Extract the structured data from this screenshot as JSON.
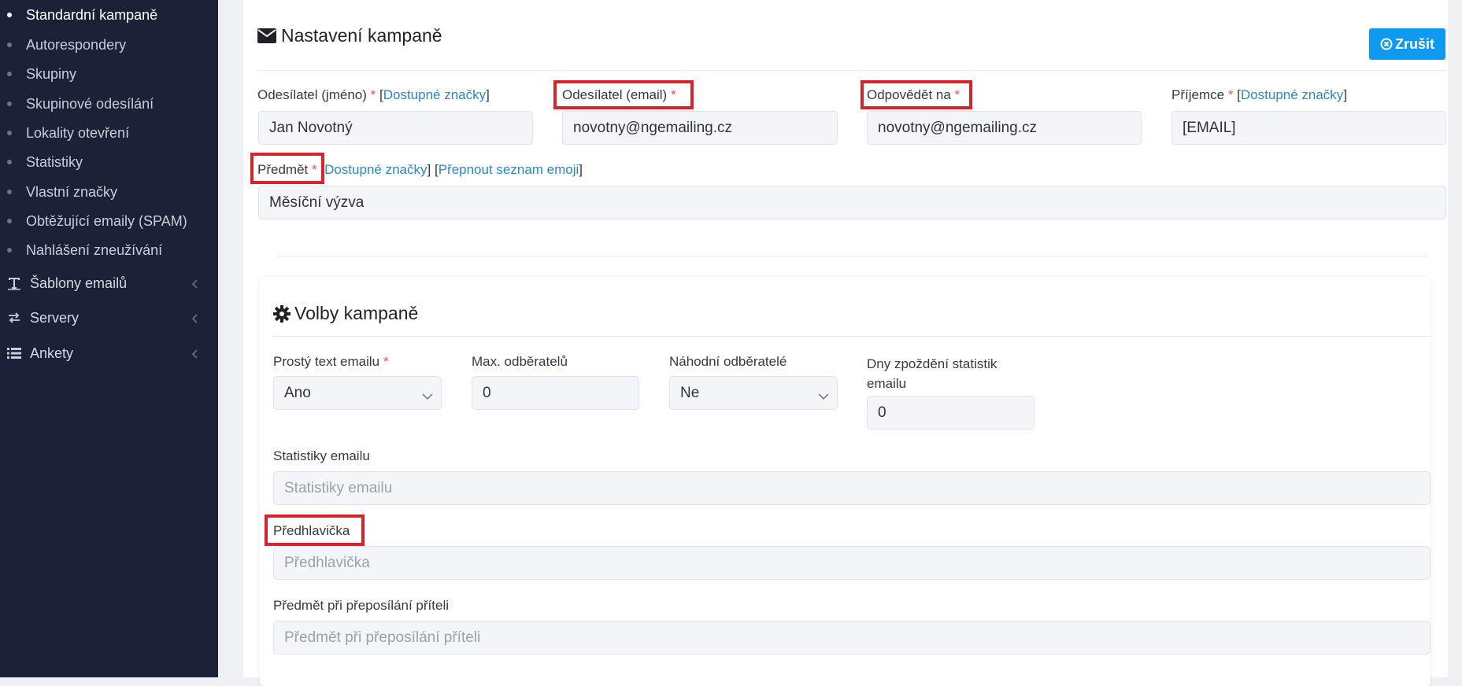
{
  "sidebar": {
    "sub_items": [
      {
        "label": "Standardní kampaně",
        "active": true
      },
      {
        "label": "Autorespondery"
      },
      {
        "label": "Skupiny"
      },
      {
        "label": "Skupinové odesílání"
      },
      {
        "label": "Lokality otevření"
      },
      {
        "label": "Statistiky"
      },
      {
        "label": "Vlastní značky"
      },
      {
        "label": "Obtěžující emaily (SPAM)"
      },
      {
        "label": "Nahlášení zneužívání"
      }
    ],
    "groups": [
      {
        "label": "Šablony emailů",
        "icon": "text-template-icon"
      },
      {
        "label": "Servery",
        "icon": "exchange-arrows-icon"
      },
      {
        "label": "Ankety",
        "icon": "list-icon"
      }
    ]
  },
  "settings": {
    "title": "Nastavení kampaně",
    "cancel_label": "Zrušit",
    "sender_name": {
      "label": "Odesílatel (jméno)",
      "tags_link": "Dostupné značky",
      "value": "Jan Novotný"
    },
    "sender_email": {
      "label": "Odesílatel (email)",
      "value": "novotny@ngemailing.cz"
    },
    "reply_to": {
      "label": "Odpovědět na",
      "value": "novotny@ngemailing.cz"
    },
    "recipient": {
      "label": "Příjemce",
      "tags_link": "Dostupné značky",
      "value": "[EMAIL]"
    },
    "subject": {
      "label": "Předmět",
      "tags_link": "Dostupné značky",
      "emoji_link": "Přepnout seznam emoji",
      "value": "Měsíční výzva"
    },
    "required_mark": "*",
    "bracket_open": "[",
    "bracket_close": "]"
  },
  "options": {
    "title": "Volby kampaně",
    "plain_text": {
      "label": "Prostý text emailu",
      "value": "Ano"
    },
    "max_subscribers": {
      "label": "Max. odběratelů",
      "value": "0"
    },
    "random_subscribers": {
      "label": "Náhodní odběratelé",
      "value": "Ne"
    },
    "stats_delay": {
      "label_line1": "Dny zpoždění statistik",
      "label_line2": "emailu",
      "value": "0"
    },
    "email_stats": {
      "label": "Statistiky emailu",
      "placeholder": "Statistiky emailu"
    },
    "preheader": {
      "label": "Předhlavička",
      "placeholder": "Předhlavička"
    },
    "forward_subject": {
      "label": "Předmět při přeposílání příteli",
      "placeholder": "Předmět při přeposílání příteli"
    }
  },
  "colors": {
    "sidebar_bg": "#1b2238",
    "accent": "#0d9af0",
    "highlight": "#d9232a",
    "link": "#2a86c8",
    "required": "#e2574c"
  }
}
